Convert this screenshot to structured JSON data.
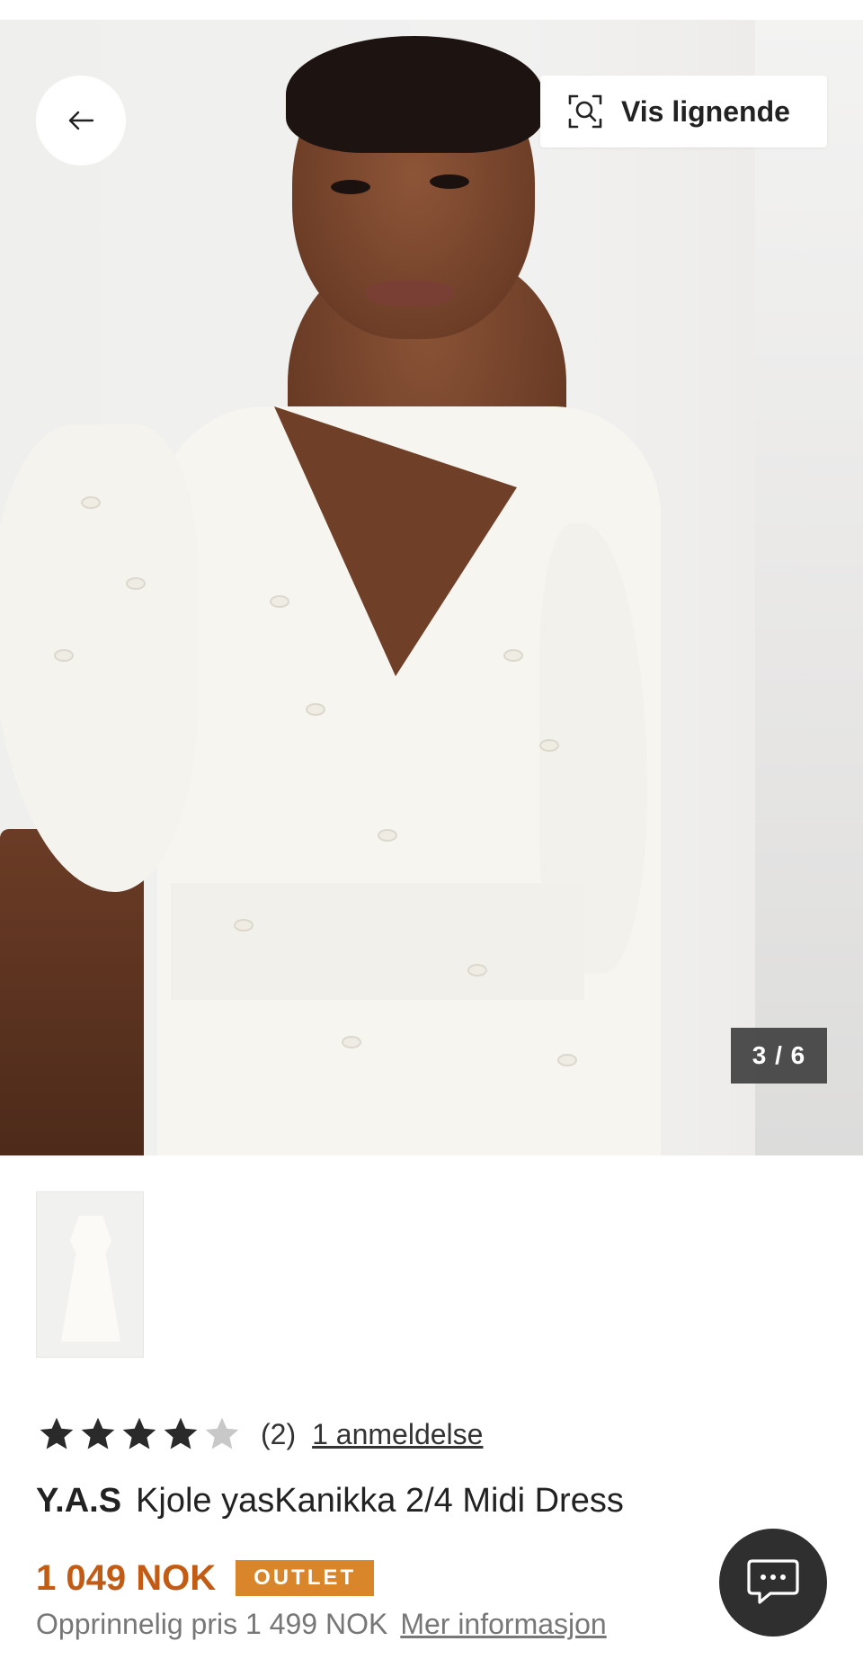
{
  "gallery": {
    "similar_label": "Vis lignende",
    "counter": "3 / 6",
    "icons": {
      "back": "arrow-left-icon",
      "similar": "visual-search-icon"
    }
  },
  "rating": {
    "stars_filled": 4,
    "stars_total": 5,
    "count": "(2)",
    "reviews_link": "1 anmeldelse"
  },
  "product": {
    "brand": "Y.A.S",
    "name": "Kjole yasKanikka 2/4 Midi Dress",
    "price": "1 049 NOK",
    "badge": "OUTLET",
    "original_price": "Opprinnelig pris 1 499 NOK",
    "more_info": "Mer informasjon"
  },
  "colors": {
    "price": "#c25b14",
    "badge_bg": "#d9862a",
    "chat_bg": "#2f2f2f",
    "star_filled": "#2a2a2a",
    "star_empty": "#c8c8c8"
  },
  "chat": {
    "icon": "chat-bubble-icon"
  }
}
